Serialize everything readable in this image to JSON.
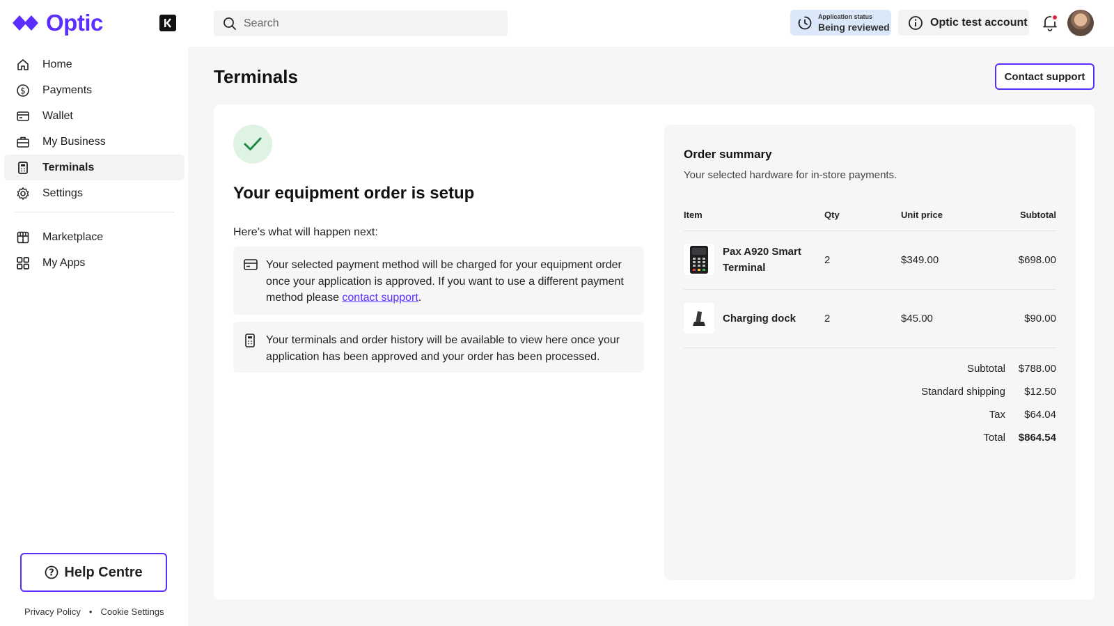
{
  "app": {
    "brand": "Optic"
  },
  "sidebar": {
    "items": [
      {
        "label": "Home",
        "icon": "home-icon"
      },
      {
        "label": "Payments",
        "icon": "dollar-icon"
      },
      {
        "label": "Wallet",
        "icon": "wallet-icon"
      },
      {
        "label": "My Business",
        "icon": "briefcase-icon"
      },
      {
        "label": "Terminals",
        "icon": "terminal-icon",
        "active": true
      },
      {
        "label": "Settings",
        "icon": "gear-icon"
      }
    ],
    "secondary_items": [
      {
        "label": "Marketplace",
        "icon": "store-icon"
      },
      {
        "label": "My Apps",
        "icon": "apps-grid-icon"
      }
    ],
    "help_label": "Help Centre",
    "footer": {
      "privacy": "Privacy Policy",
      "separator": "•",
      "cookies": "Cookie Settings"
    }
  },
  "header": {
    "search_placeholder": "Search",
    "status_label": "Application status",
    "status_value": "Being reviewed",
    "account_name": "Optic test account"
  },
  "page": {
    "title": "Terminals",
    "contact_label": "Contact support"
  },
  "confirmation": {
    "heading": "Your equipment order is setup",
    "next_label": "Here’s what will happen next:",
    "info_1_text": "Your selected payment method will be charged for your equipment order once your application is approved. If you want to use a different payment method please ",
    "info_1_link": "contact support",
    "info_1_end": ".",
    "info_2_text": "Your terminals and order history will be available to view here once your application has been approved and your order has been processed."
  },
  "summary": {
    "title": "Order summary",
    "subtitle": "Your selected hardware for in-store payments.",
    "columns": {
      "item": "Item",
      "qty": "Qty",
      "unit_price": "Unit price",
      "subtotal": "Subtotal"
    },
    "items": [
      {
        "name_line1": "Pax A920 Smart",
        "name_line2": "Terminal",
        "qty": "2",
        "unit_price": "$349.00",
        "subtotal": "$698.00"
      },
      {
        "name_line1": "Charging dock",
        "name_line2": "",
        "qty": "2",
        "unit_price": "$45.00",
        "subtotal": "$90.00"
      }
    ],
    "totals": {
      "subtotal_label": "Subtotal",
      "subtotal": "$788.00",
      "shipping_label": "Standard shipping",
      "shipping": "$12.50",
      "tax_label": "Tax",
      "tax": "$64.04",
      "total_label": "Total",
      "total": "$864.54"
    }
  },
  "colors": {
    "brand": "#5b2eff",
    "status_bg": "#dbe8fa",
    "success_bg": "#dff3e4",
    "success": "#1e8a45",
    "notification_dot": "#e5243b"
  }
}
